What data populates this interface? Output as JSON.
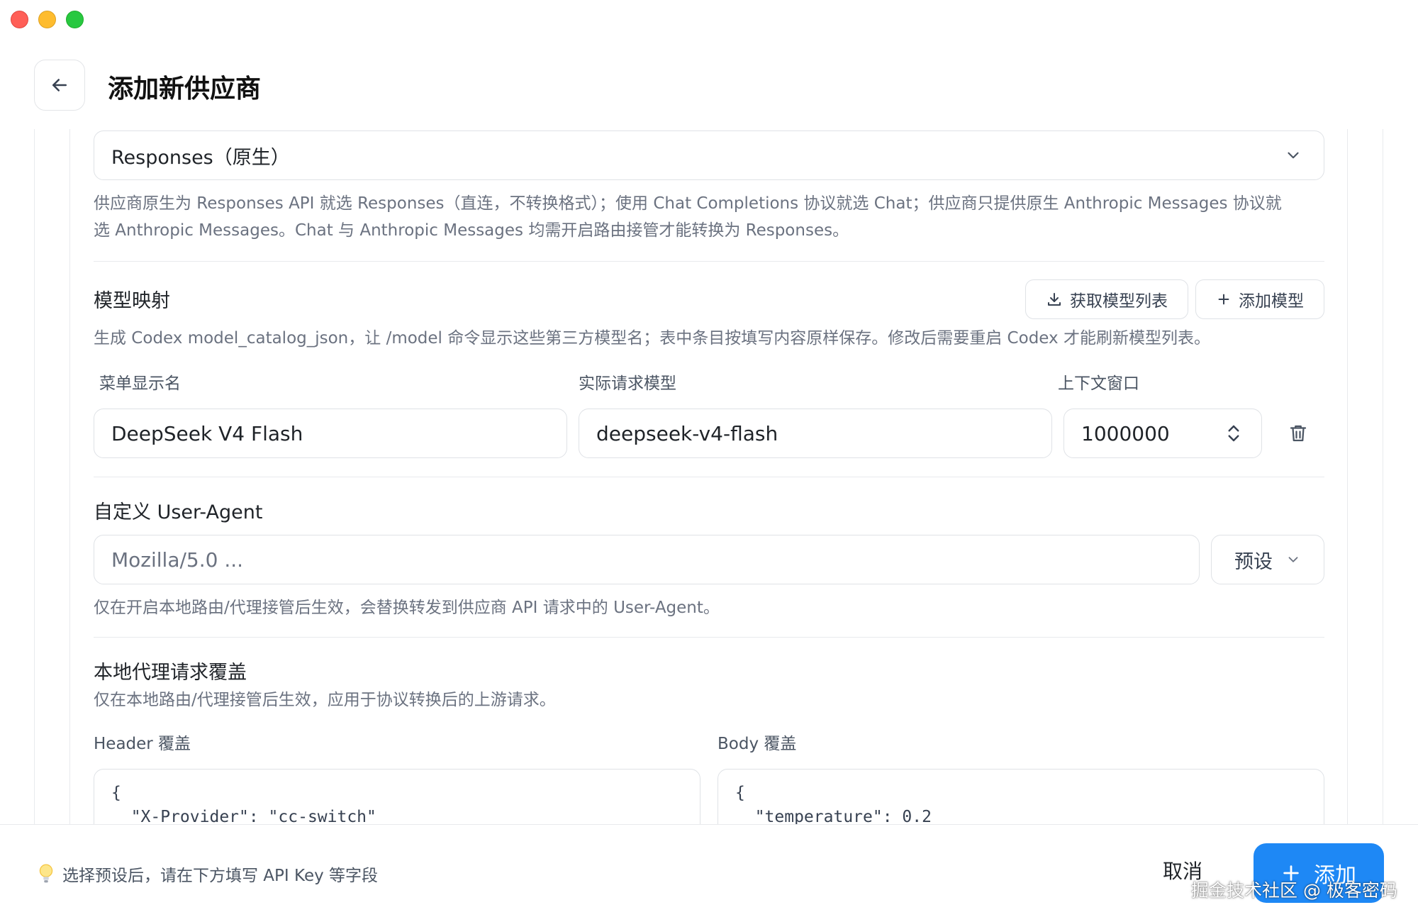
{
  "header": {
    "title": "添加新供应商"
  },
  "api_format": {
    "selected": "Responses（原生）",
    "hint_line1": "供应商原生为 Responses API 就选 Responses（直连，不转换格式）；使用 Chat Completions 协议就选 Chat；供应商只提供原生 Anthropic Messages 协议就",
    "hint_line2": "选 Anthropic Messages。Chat 与 Anthropic Messages 均需开启路由接管才能转换为 Responses。"
  },
  "model_mapping": {
    "title": "模型映射",
    "fetch_button": "获取模型列表",
    "add_button": "添加模型",
    "hint": "生成 Codex model_catalog_json，让 /model 命令显示这些第三方模型名；表中条目按填写内容原样保存。修改后需要重启 Codex 才能刷新模型列表。",
    "columns": [
      "菜单显示名",
      "实际请求模型",
      "上下文窗口"
    ],
    "rows": [
      {
        "display_name": "DeepSeek V4 Flash",
        "request_model": "deepseek-v4-flash",
        "context_window": "1000000"
      }
    ]
  },
  "user_agent": {
    "title": "自定义 User-Agent",
    "placeholder": "Mozilla/5.0 ...",
    "preset_label": "预设",
    "hint": "仅在开启本地路由/代理接管后生效，会替换转发到供应商 API 请求中的 User-Agent。"
  },
  "override": {
    "title": "本地代理请求覆盖",
    "hint": "仅在本地路由/代理接管后生效，应用于协议转换后的上游请求。",
    "header_label": "Header 覆盖",
    "header_code_line1": "{",
    "header_code_line2": "  \"X-Provider\": \"cc-switch\"",
    "body_label": "Body 覆盖",
    "body_code_line1": "{",
    "body_code_line2": "  \"temperature\": 0.2"
  },
  "footer": {
    "hint": "选择预设后，请在下方填写 API Key 等字段",
    "cancel_label": "取消",
    "add_label": "添加"
  },
  "watermark": "掘金技术社区 @ 极客密码",
  "colors": {
    "accent": "#1e88f5",
    "border": "#dfe2e6",
    "hint_text": "#6b7280"
  },
  "icons": [
    "back-arrow-icon",
    "chevron-down-icon",
    "download-icon",
    "plus-icon",
    "spinner-updown-icon",
    "trash-icon",
    "lightbulb-icon"
  ]
}
